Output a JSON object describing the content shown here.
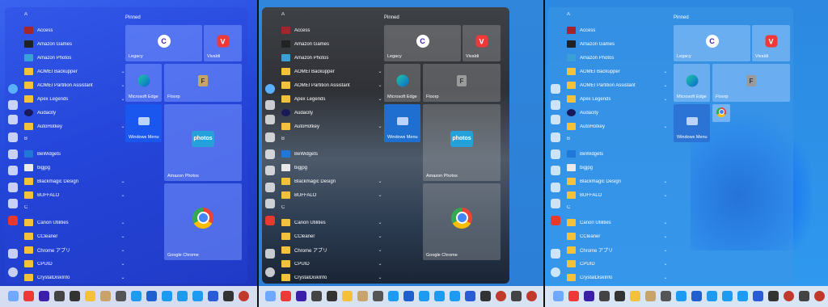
{
  "start_menu": {
    "pinned_label": "Pinned",
    "letters": [
      "A",
      "B",
      "C"
    ],
    "apps": [
      {
        "label": "Access",
        "icon": "access-icon",
        "chevron": false
      },
      {
        "label": "Amazon Games",
        "icon": "amazon-games-icon",
        "chevron": false
      },
      {
        "label": "Amazon Photos",
        "icon": "amazon-photos-icon",
        "chevron": false
      },
      {
        "label": "AOMEI Backupper",
        "icon": "folder-icon",
        "chevron": true
      },
      {
        "label": "AOMEI Partition Assistant",
        "icon": "folder-icon",
        "chevron": true
      },
      {
        "label": "Apex Legends",
        "icon": "folder-icon",
        "chevron": true
      },
      {
        "label": "Audacity",
        "icon": "audacity-icon",
        "chevron": false
      },
      {
        "label": "AutoHotkey",
        "icon": "folder-icon",
        "chevron": true
      },
      {
        "label": "BeWidgets",
        "icon": "bewidgets-icon",
        "chevron": false
      },
      {
        "label": "bigjpg",
        "icon": "bigjpg-icon",
        "chevron": false
      },
      {
        "label": "Blackmagic Design",
        "icon": "folder-icon",
        "chevron": true
      },
      {
        "label": "BUFFALO",
        "icon": "folder-icon",
        "chevron": true
      },
      {
        "label": "Canon Utilities",
        "icon": "folder-icon",
        "chevron": true
      },
      {
        "label": "CCleaner",
        "icon": "folder-icon",
        "chevron": true
      },
      {
        "label": "Chrome アプリ",
        "icon": "folder-icon",
        "chevron": true
      },
      {
        "label": "CPUID",
        "icon": "folder-icon",
        "chevron": true
      },
      {
        "label": "CrystalDiskInfo",
        "icon": "folder-icon",
        "chevron": true
      }
    ],
    "tiles": [
      {
        "label": "Legacy",
        "icon": "legacy-icon"
      },
      {
        "label": "Vivaldi",
        "icon": "vivaldi-icon"
      },
      {
        "label": "Microsoft Edge",
        "icon": "edge-icon"
      },
      {
        "label": "Floorp",
        "icon": "floorp-icon"
      },
      {
        "label": "Windows Menu",
        "icon": "windows-menu-icon"
      },
      {
        "label": "Amazon Photos",
        "icon": "amazon-photos-icon",
        "glyph": "photos"
      },
      {
        "label": "Google Chrome",
        "icon": "chrome-icon"
      }
    ]
  },
  "colors": {
    "folder": "#f3c13a",
    "panel1_bg": "#2346d8",
    "panel2_bg": "#2f3136",
    "panel3_bg": "#2f9af0"
  }
}
